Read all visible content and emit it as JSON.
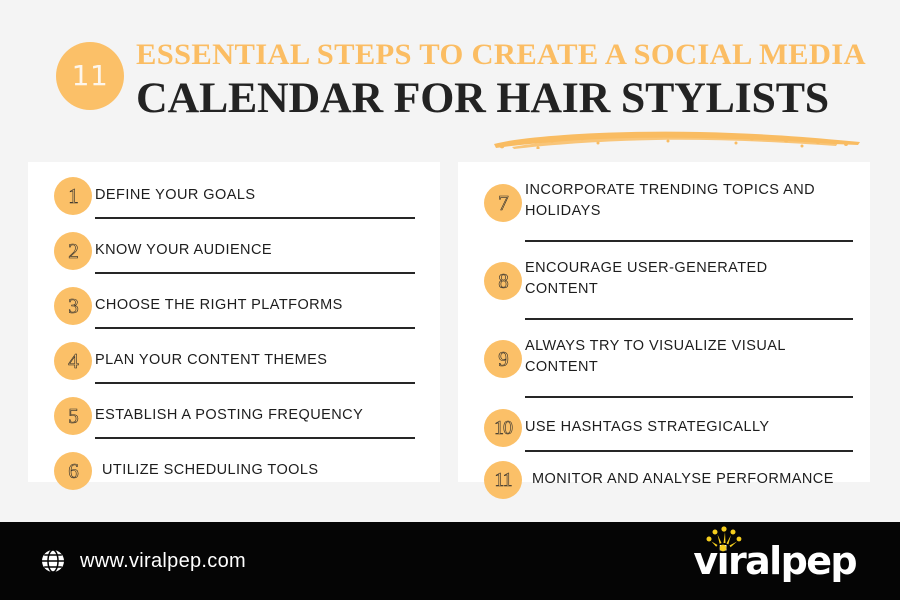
{
  "header": {
    "badge_number": "11",
    "title_line1": "ESSENTIAL STEPS TO CREATE A SOCIAL MEDIA",
    "title_line2": "CALENDAR FOR HAIR STYLISTS",
    "accent_color": "#FBC068",
    "title_color": "#232323",
    "brush_underline_color": "#F9BC62"
  },
  "background_color": "#F4F4F4",
  "card_color": "#FFFFFF",
  "left_column": {
    "items": [
      {
        "number": "1",
        "text": "DEFINE YOUR GOALS"
      },
      {
        "number": "2",
        "text": "KNOW YOUR AUDIENCE"
      },
      {
        "number": "3",
        "text": "CHOOSE THE RIGHT PLATFORMS"
      },
      {
        "number": "4",
        "text": "PLAN YOUR CONTENT THEMES"
      },
      {
        "number": "5",
        "text": "ESTABLISH A POSTING FREQUENCY"
      },
      {
        "number": "6",
        "text": "UTILIZE SCHEDULING TOOLS"
      }
    ]
  },
  "right_column": {
    "items": [
      {
        "number": "7",
        "text": "INCORPORATE TRENDING TOPICS AND HOLIDAYS"
      },
      {
        "number": "8",
        "text": "ENCOURAGE USER-GENERATED CONTENT"
      },
      {
        "number": "9",
        "text": "ALWAYS TRY TO VISUALIZE VISUAL CONTENT"
      },
      {
        "number": "10",
        "text": "USE HASHTAGS STRATEGICALLY"
      },
      {
        "number": "11",
        "text": "MONITOR AND ANALYSE PERFORMANCE"
      }
    ]
  },
  "footer": {
    "background_color": "#050505",
    "url": "www.viralpep.com",
    "globe_icon": "globe-icon",
    "logo_text": "viralpep",
    "logo_sparkle_color": "#F5CE1E",
    "logo_text_color": "#FFFFFF"
  }
}
